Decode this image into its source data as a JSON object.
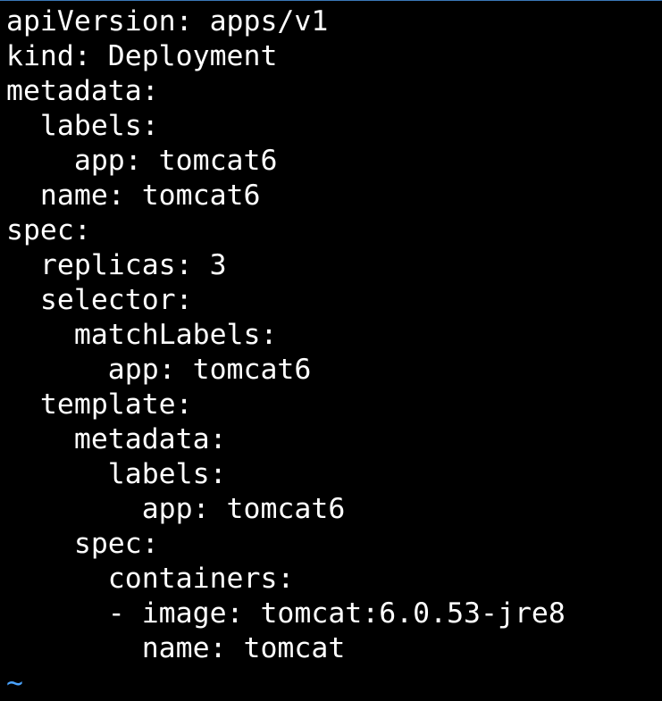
{
  "editor": {
    "lines": [
      "apiVersion: apps/v1",
      "kind: Deployment",
      "metadata:",
      "  labels:",
      "    app: tomcat6",
      "  name: tomcat6",
      "spec:",
      "  replicas: 3",
      "  selector:",
      "    matchLabels:",
      "      app: tomcat6",
      "  template:",
      "    metadata:",
      "      labels:",
      "        app: tomcat6",
      "    spec:",
      "      containers:",
      "      - image: tomcat:6.0.53-jre8",
      "        name: tomcat"
    ],
    "empty_line_marker": "~"
  },
  "colors": {
    "background": "#000000",
    "text": "#ffffff",
    "tilde": "#4aa3ff"
  }
}
